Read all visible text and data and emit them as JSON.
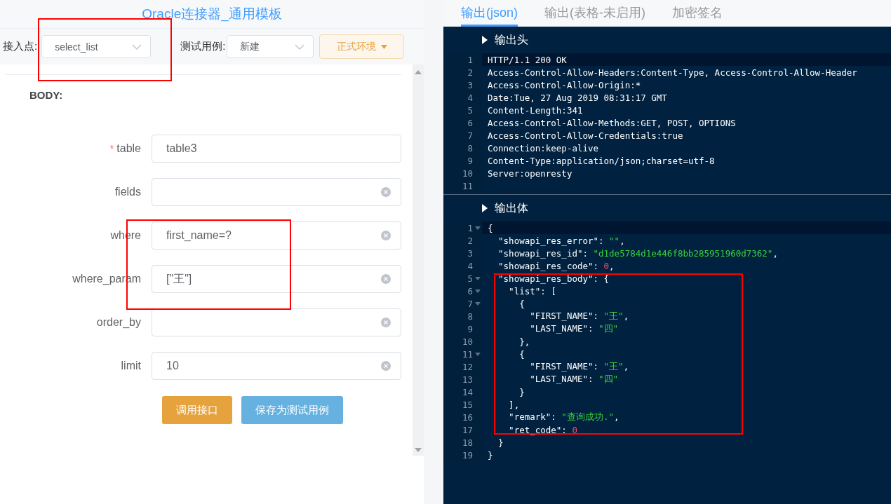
{
  "title": "Oracle连接器_通用模板",
  "toolbar": {
    "entry_label": "接入点:",
    "entry_value": "select_list",
    "case_label": "测试用例:",
    "case_value": "新建",
    "env_button": "正式环境"
  },
  "body_label": "BODY:",
  "fields": [
    {
      "label": "table",
      "required_mark": "*",
      "value": "table3",
      "clear_icon": false
    },
    {
      "label": "fields",
      "clear_icon": true
    },
    {
      "label": "where",
      "value": "first_name=?",
      "clear_icon": true
    },
    {
      "label": "where_param",
      "value": "[\"王\"]",
      "clear_icon": true
    },
    {
      "label": "order_by",
      "clear_icon": true
    },
    {
      "label": "limit",
      "value": "10",
      "clear_icon": true
    }
  ],
  "buttons": [
    {
      "label": "调用接口",
      "kind": "primary"
    },
    {
      "label": "保存为测试用例",
      "kind": "secondary"
    }
  ],
  "tabs": [
    {
      "label": "输出(json)",
      "selected": true
    },
    {
      "label": "输出(表格-未启用)",
      "selected": false
    },
    {
      "label": "加密签名",
      "selected": false
    }
  ],
  "sections": [
    {
      "title": "输出头",
      "lines": [
        {
          "n": "1",
          "active": true,
          "fold": false,
          "tokens": [
            {
              "kind": "text",
              "text": "HTTP/1.1 200 OK"
            }
          ]
        },
        {
          "n": "2",
          "active": false,
          "fold": false,
          "tokens": [
            {
              "kind": "text",
              "text": "Access-Control-Allow-Headers:Content-Type, Access-Control-Allow-Header"
            }
          ]
        },
        {
          "n": "3",
          "active": false,
          "fold": false,
          "tokens": [
            {
              "kind": "text",
              "text": "Access-Control-Allow-Origin:*"
            }
          ]
        },
        {
          "n": "4",
          "active": false,
          "fold": false,
          "tokens": [
            {
              "kind": "text",
              "text": "Date:Tue, 27 Aug 2019 08:31:17 GMT"
            }
          ]
        },
        {
          "n": "5",
          "active": false,
          "fold": false,
          "tokens": [
            {
              "kind": "text",
              "text": "Content-Length:341"
            }
          ]
        },
        {
          "n": "6",
          "active": false,
          "fold": false,
          "tokens": [
            {
              "kind": "text",
              "text": "Access-Control-Allow-Methods:GET, POST, OPTIONS"
            }
          ]
        },
        {
          "n": "7",
          "active": false,
          "fold": false,
          "tokens": [
            {
              "kind": "text",
              "text": "Access-Control-Allow-Credentials:true"
            }
          ]
        },
        {
          "n": "8",
          "active": false,
          "fold": false,
          "tokens": [
            {
              "kind": "text",
              "text": "Connection:keep-alive"
            }
          ]
        },
        {
          "n": "9",
          "active": false,
          "fold": false,
          "tokens": [
            {
              "kind": "text",
              "text": "Content-Type:application/json;charset=utf-8"
            }
          ]
        },
        {
          "n": "10",
          "active": false,
          "fold": false,
          "tokens": [
            {
              "kind": "text",
              "text": "Server:openresty"
            }
          ]
        },
        {
          "n": "11",
          "active": false,
          "fold": false
        }
      ]
    },
    {
      "title": "输出体",
      "lines": [
        {
          "n": "1",
          "active": true,
          "fold": true,
          "tokens": [
            {
              "kind": "punct",
              "text": "{"
            }
          ]
        },
        {
          "n": "2",
          "active": false,
          "fold": false,
          "tokens": [
            {
              "kind": "key",
              "text": "  \"showapi_res_error\": "
            },
            {
              "kind": "string",
              "text": "\"\""
            },
            {
              "kind": "punct",
              "text": ","
            }
          ]
        },
        {
          "n": "3",
          "active": false,
          "fold": false,
          "tokens": [
            {
              "kind": "key",
              "text": "  \"showapi_res_id\": "
            },
            {
              "kind": "string",
              "text": "\"d1de5784d1e446f8bb285951960d7362\""
            },
            {
              "kind": "punct",
              "text": ","
            }
          ]
        },
        {
          "n": "4",
          "active": false,
          "fold": false,
          "tokens": [
            {
              "kind": "key",
              "text": "  \"showapi_res_code\": "
            },
            {
              "kind": "number",
              "text": "0"
            },
            {
              "kind": "punct",
              "text": ","
            }
          ]
        },
        {
          "n": "5",
          "active": false,
          "fold": true,
          "tokens": [
            {
              "kind": "key",
              "text": "  \"showapi_res_body\": {"
            }
          ]
        },
        {
          "n": "6",
          "active": false,
          "fold": true,
          "tokens": [
            {
              "kind": "key",
              "text": "    \"list\": ["
            }
          ]
        },
        {
          "n": "7",
          "active": false,
          "fold": true,
          "tokens": [
            {
              "kind": "punct",
              "text": "      {"
            }
          ]
        },
        {
          "n": "8",
          "active": false,
          "fold": false,
          "tokens": [
            {
              "kind": "key",
              "text": "        \"FIRST_NAME\": "
            },
            {
              "kind": "string",
              "text": "\"王\""
            },
            {
              "kind": "punct",
              "text": ","
            }
          ]
        },
        {
          "n": "9",
          "active": false,
          "fold": false,
          "tokens": [
            {
              "kind": "key",
              "text": "        \"LAST_NAME\": "
            },
            {
              "kind": "string",
              "text": "\"四\""
            }
          ]
        },
        {
          "n": "10",
          "active": false,
          "fold": false,
          "tokens": [
            {
              "kind": "punct",
              "text": "      },"
            }
          ]
        },
        {
          "n": "11",
          "active": false,
          "fold": true,
          "tokens": [
            {
              "kind": "punct",
              "text": "      {"
            }
          ]
        },
        {
          "n": "12",
          "active": false,
          "fold": false,
          "tokens": [
            {
              "kind": "key",
              "text": "        \"FIRST_NAME\": "
            },
            {
              "kind": "string",
              "text": "\"王\""
            },
            {
              "kind": "punct",
              "text": ","
            }
          ]
        },
        {
          "n": "13",
          "active": false,
          "fold": false,
          "tokens": [
            {
              "kind": "key",
              "text": "        \"LAST_NAME\": "
            },
            {
              "kind": "string",
              "text": "\"四\""
            }
          ]
        },
        {
          "n": "14",
          "active": false,
          "fold": false,
          "tokens": [
            {
              "kind": "punct",
              "text": "      }"
            }
          ]
        },
        {
          "n": "15",
          "active": false,
          "fold": false,
          "tokens": [
            {
              "kind": "punct",
              "text": "    ],"
            }
          ]
        },
        {
          "n": "16",
          "active": false,
          "fold": false,
          "tokens": [
            {
              "kind": "key",
              "text": "    \"remark\": "
            },
            {
              "kind": "string",
              "text": "\"查询成功.\""
            },
            {
              "kind": "punct",
              "text": ","
            }
          ]
        },
        {
          "n": "17",
          "active": false,
          "fold": false,
          "tokens": [
            {
              "kind": "key",
              "text": "    \"ret_code\": "
            },
            {
              "kind": "number",
              "text": "0"
            }
          ]
        },
        {
          "n": "18",
          "active": false,
          "fold": false,
          "tokens": [
            {
              "kind": "punct",
              "text": "  }"
            }
          ]
        },
        {
          "n": "19",
          "active": false,
          "fold": false,
          "tokens": [
            {
              "kind": "punct",
              "text": "}"
            }
          ]
        }
      ]
    }
  ]
}
